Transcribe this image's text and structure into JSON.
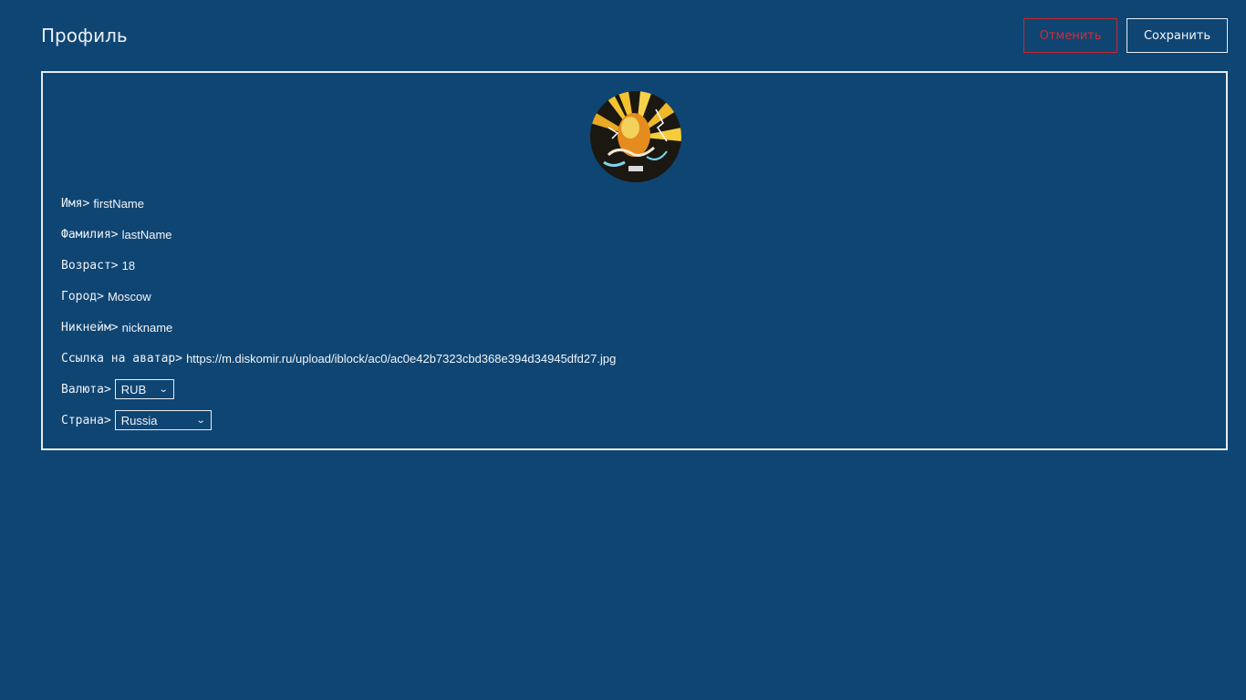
{
  "header": {
    "title": "Профиль",
    "cancel_label": "Отменить",
    "save_label": "Сохранить"
  },
  "profile": {
    "fields": [
      {
        "label": "Имя>",
        "value": "firstName"
      },
      {
        "label": "Фамилия>",
        "value": "lastName"
      },
      {
        "label": "Возраст>",
        "value": "18"
      },
      {
        "label": "Город>",
        "value": "Moscow"
      },
      {
        "label": "Никнейм>",
        "value": "nickname"
      },
      {
        "label": "Ссылка на аватар>",
        "value": "https://m.diskomir.ru/upload/iblock/ac0/ac0e42b7323cbd368e394d34945dfd27.jpg"
      }
    ],
    "currency": {
      "label": "Валюта>",
      "selected": "RUB"
    },
    "country": {
      "label": "Страна>",
      "selected": "Russia"
    }
  },
  "colors": {
    "background": "#0f4573",
    "border": "#e6ecf2",
    "cancel": "#d72a31"
  }
}
